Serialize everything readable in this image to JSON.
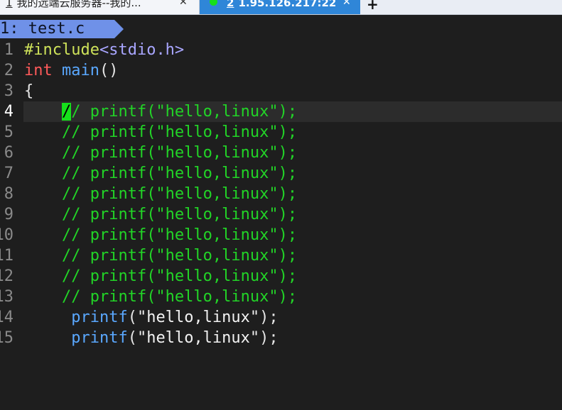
{
  "tabs": [
    {
      "number": "1",
      "title": "我的远端云服务器--我的...",
      "close": "✕",
      "active": false
    },
    {
      "number": "2",
      "title": "1.95.126.217:22",
      "close": "✕",
      "active": true,
      "status_color": "#16e01b"
    }
  ],
  "add_tab": "+",
  "statusline": {
    "text": "1: test.c",
    "color": "#6f91e8"
  },
  "editor": {
    "current_line": 4,
    "lines": [
      {
        "n": "1",
        "a": "#include",
        "b": "<stdio.h>"
      },
      {
        "n": "2",
        "a": "int",
        "sp": " ",
        "b": "main",
        "c": "()"
      },
      {
        "n": "3",
        "a": "{"
      },
      {
        "n": "4",
        "indent": "    ",
        "cursor": "/",
        "comment": "/ printf(\"hello,linux\");"
      },
      {
        "n": "5",
        "indent": "    ",
        "comment": "// printf(\"hello,linux\");"
      },
      {
        "n": "6",
        "indent": "    ",
        "comment": "// printf(\"hello,linux\");"
      },
      {
        "n": "7",
        "indent": "    ",
        "comment": "// printf(\"hello,linux\");"
      },
      {
        "n": "8",
        "indent": "    ",
        "comment": "// printf(\"hello,linux\");"
      },
      {
        "n": "9",
        "indent": "    ",
        "comment": "// printf(\"hello,linux\");"
      },
      {
        "n": "10",
        "indent": "    ",
        "comment": "// printf(\"hello,linux\");"
      },
      {
        "n": "11",
        "indent": "    ",
        "comment": "// printf(\"hello,linux\");"
      },
      {
        "n": "12",
        "indent": "    ",
        "comment": "// printf(\"hello,linux\");"
      },
      {
        "n": "13",
        "indent": "    ",
        "comment": "// printf(\"hello,linux\");"
      },
      {
        "n": "14",
        "indent": "     ",
        "fn": "printf",
        "p1": "(",
        "str": "\"hello,linux\"",
        "p2": ");"
      },
      {
        "n": "15",
        "indent": "     ",
        "fn": "printf",
        "p1": "(",
        "str": "\"hello,linux\"",
        "p2": ");"
      }
    ]
  },
  "colors": {
    "background": "#1e1e1e",
    "comment": "#22d427",
    "keyword": "#ff5a5a",
    "function": "#5aa8ff",
    "preprocessor": "#cfe35a",
    "header": "#a9a6ff",
    "cursor": "#16e01b",
    "active_tab": "#2f86d8"
  },
  "icons": {
    "tab_close": "close-icon",
    "tab_status": "connected-dot-icon",
    "new_tab": "plus-icon"
  }
}
